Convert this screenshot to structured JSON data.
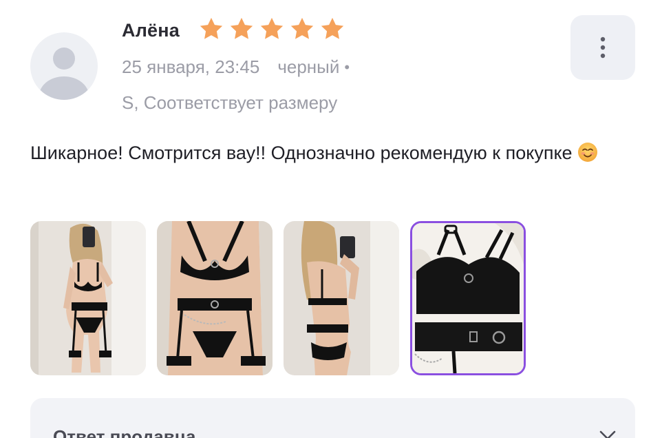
{
  "review": {
    "author": "Алёна",
    "rating": 5,
    "rating_max": 5,
    "date": "25 января, 23:45",
    "color": "черный",
    "separator": "•",
    "size_fit": "S, Соответствует размеру",
    "text": "Шикарное! Смотрится вау!! Однозначно рекомендую к покупке",
    "emoji_icon": "smiling-face-emoji-icon",
    "star_color": "#f5a15a",
    "menu_icon": "vertical-dots-icon"
  },
  "photos": [
    {
      "name": "photo-1",
      "selected": false
    },
    {
      "name": "photo-2",
      "selected": false
    },
    {
      "name": "photo-3",
      "selected": false
    },
    {
      "name": "photo-4",
      "selected": true
    }
  ],
  "seller_reply": {
    "title": "Ответ продавца",
    "toggle_icon": "chevron-down-icon"
  },
  "colors": {
    "selected_border": "#8a4fe0",
    "muted_text": "#9b9ca6",
    "panel_bg": "#f2f3f7"
  }
}
